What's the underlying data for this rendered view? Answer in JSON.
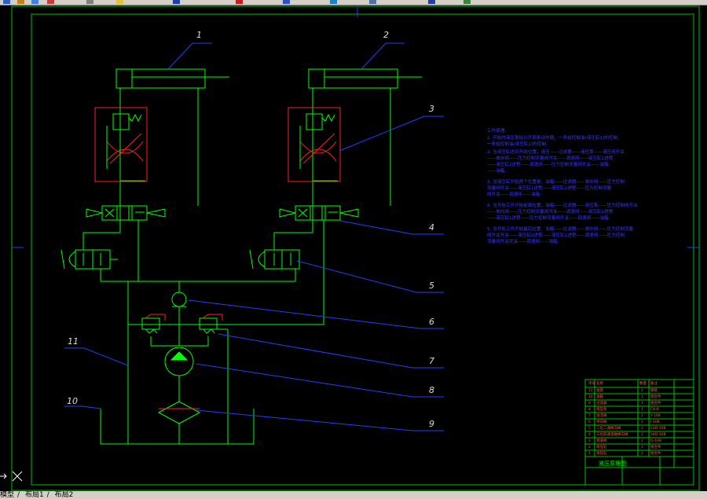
{
  "colors": {
    "background": "#000000",
    "frame": "#00c000",
    "circuit": "#00ff00",
    "valve_box": "#ff2020",
    "leader": "#2040ff",
    "notes": "#3a3aff",
    "toolbar": "#d4d0c8"
  },
  "callouts": [
    "1",
    "2",
    "3",
    "4",
    "5",
    "6",
    "7",
    "8",
    "9",
    "10",
    "11"
  ],
  "notes": {
    "title": "工作原理:",
    "lines": [
      "1. 开始时液压泵给分开两条动作路，一条给控制油(液压缸1)的控制,",
      "   一条给控制油(液压缸2)的控制;",
      "2. 当液压缸进到开始位置，液压——过滤器——液压泵——液压阀开关",
      "   ——单向阀——压力控制流量阀开关——调速阀——液压缸1进程",
      "   ——液压缸2进程——调速阀——压力控制流量阀开关——油箱;",
      "   ——油箱。",
      "3. 当液压缸开始两个位置是，油箱——过滤器——单向阀——压力控制",
      "   流量阀开关——液压缸1进程——液压缸2进程——压力控制流量",
      "   阀开关——调速阀——油箱;",
      "4. 当开始工作开始前面位置，油箱——过滤器——液压泵——压力控制阀开关",
      "   ——单向阀——压力控制流量阀开关——调速阀——液压缸2进程",
      "   ——液压缸1进程——压力控制流量阀开关——调速阀——油箱;",
      "5. 当开始工作开始最后位置，油箱——过滤器——单向阀——压力控制流量",
      "   阀开关开关——液压缸2进程——液压缸1进程——调速阀——压力控制",
      "   流量阀开关开关——调速阀——油箱。"
    ]
  },
  "title_block": {
    "rows": [
      [
        "11",
        "油管",
        "2",
        "钢管"
      ],
      [
        "10",
        "油箱",
        "1",
        "组合件"
      ],
      [
        "9",
        "过滤器",
        "1",
        "组合件"
      ],
      [
        "8",
        "液压泵",
        "1",
        "CB-B"
      ],
      [
        "7",
        "溢流阀",
        "2",
        "Y-10B"
      ],
      [
        "6",
        "单向阀",
        "1",
        "I-10B"
      ],
      [
        "5",
        "二位二通换向阀",
        "2",
        "22D-10B"
      ],
      [
        "4",
        "三位四通电磁换向阀",
        "2",
        "34D-10B"
      ],
      [
        "3",
        "调速阀",
        "2",
        "Q-10B"
      ],
      [
        "2",
        "液压缸",
        "1",
        "组合件"
      ],
      [
        "1",
        "液压缸",
        "1",
        "组合件"
      ]
    ],
    "header": [
      "序号",
      "名称",
      "数量",
      "备注"
    ],
    "drawing_name": "液压原理图"
  },
  "layout_tabs": [
    "模型",
    "布局1",
    "布局2"
  ]
}
